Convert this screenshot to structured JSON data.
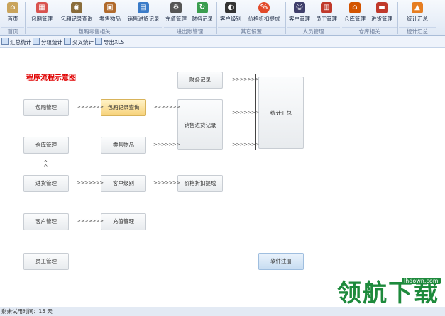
{
  "ribbon": {
    "buttons": [
      {
        "label": "首页",
        "icon": "home-icon",
        "color": "#c9a45c"
      },
      {
        "label": "包厢管理",
        "icon": "room-icon",
        "color": "#d9534f"
      },
      {
        "label": "包厢记录查询",
        "icon": "record-icon",
        "color": "#8a6d3b"
      },
      {
        "label": "零售物品",
        "icon": "goods-icon",
        "color": "#b06a2c"
      },
      {
        "label": "销售进货记录",
        "icon": "sales-icon",
        "color": "#3a7bc8"
      },
      {
        "label": "充值管理",
        "icon": "gear-icon",
        "color": "#555555"
      },
      {
        "label": "财务记录",
        "icon": "refresh-icon",
        "color": "#3a9d4f"
      },
      {
        "label": "客户级别",
        "icon": "level-icon",
        "color": "#333333"
      },
      {
        "label": "价格折扣提成",
        "icon": "percent-icon",
        "color": "#e24a2a"
      },
      {
        "label": "客户管理",
        "icon": "customer-icon",
        "color": "#3f3f6b"
      },
      {
        "label": "员工管理",
        "icon": "staff-icon",
        "color": "#c0392b"
      },
      {
        "label": "仓库管理",
        "icon": "warehouse-icon",
        "color": "#d35400"
      },
      {
        "label": "进货管理",
        "icon": "truck-icon",
        "color": "#c0392b"
      },
      {
        "label": "统计汇总",
        "icon": "chart-icon",
        "color": "#e67e22"
      }
    ],
    "groups": [
      "首页",
      "包厢零售相关",
      "进出账管理",
      "其它设置",
      "人员管理",
      "仓库相关",
      "统计汇总"
    ]
  },
  "toolbar": {
    "items": [
      "汇总统计",
      "分组统计",
      "交叉统计",
      "导出XLS"
    ]
  },
  "flow": {
    "title": "程序流程示意图",
    "boxes": {
      "room_mgmt": "包厢管理",
      "room_query": "包厢记录查询",
      "finance": "财务记录",
      "sales": "销售进货记录",
      "stats": "统计汇总",
      "warehouse": "仓库管理",
      "retail": "零售物品",
      "purchase": "进货管理",
      "cust_level": "客户级别",
      "discount": "价格折扣提成",
      "customer": "客户管理",
      "recharge": "充值管理",
      "staff": "员工管理",
      "register": "软件注册"
    },
    "arrow": ">>>>>>>"
  },
  "status": {
    "text": "剩余试用时间：15 天"
  },
  "watermark": {
    "text": "领航下载",
    "url": "lhdown.com"
  }
}
